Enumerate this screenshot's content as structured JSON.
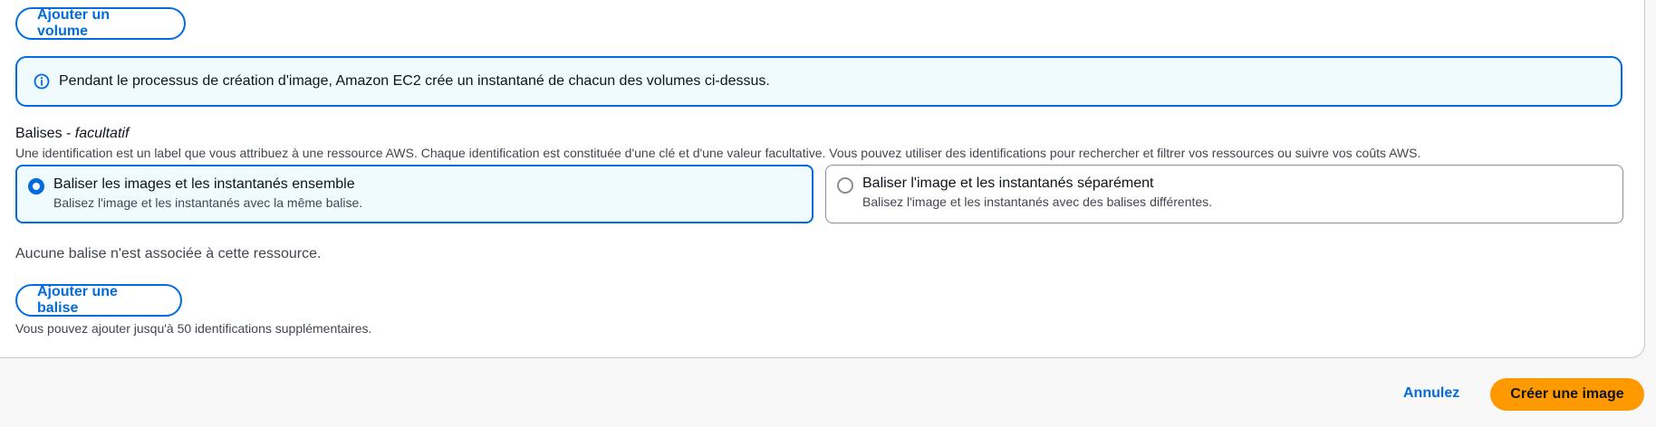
{
  "storage": {
    "add_volume_label": "Ajouter un volume"
  },
  "info": {
    "icon": "info-circle-icon",
    "text": "Pendant le processus de création d'image, Amazon EC2 crée un instantané de chacun des volumes ci-dessus."
  },
  "tags": {
    "label": "Balises - ",
    "optional": "facultatif",
    "description": "Une identification est un label que vous attribuez à une ressource AWS. Chaque identification est constituée d'une clé et d'une valeur facultative. Vous pouvez utiliser des identifications pour rechercher et filtrer vos ressources ou suivre vos coûts AWS.",
    "options": [
      {
        "title": "Baliser les images et les instantanés ensemble",
        "description": "Balisez l'image et les instantanés avec la même balise.",
        "selected": true
      },
      {
        "title": "Baliser l'image et les instantanés séparément",
        "description": "Balisez l'image et les instantanés avec des balises différentes.",
        "selected": false
      }
    ],
    "empty_text": "Aucune balise n'est associée à cette ressource.",
    "add_tag_label": "Ajouter une balise",
    "limit_hint": "Vous pouvez ajouter jusqu'à 50 identifications supplémentaires."
  },
  "footer": {
    "cancel_label": "Annulez",
    "create_label": "Créer une image"
  },
  "colors": {
    "accent": "#006ce0",
    "primary_button": "#ff9900",
    "info_bg": "#f0fbff"
  }
}
